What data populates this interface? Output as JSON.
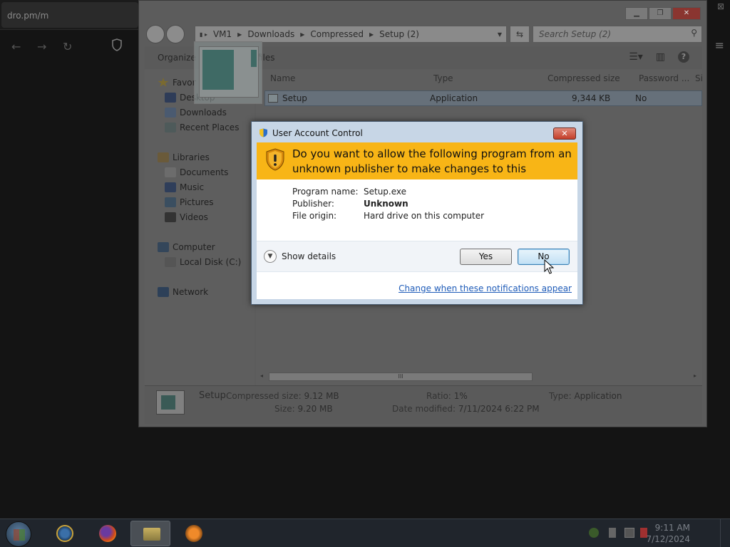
{
  "browser": {
    "tab_text": "dro.pm/m",
    "nav_glyphs": {
      "back": "←",
      "forward": "→",
      "reload": "↻"
    },
    "corner_close": "⊠",
    "menu_glyph": "≡"
  },
  "explorer": {
    "breadcrumb": [
      "VM1",
      "Downloads",
      "Compressed",
      "Setup (2)"
    ],
    "search_placeholder": "Search Setup (2)",
    "toolbar": {
      "organize": "Organize",
      "extract": "files"
    },
    "nav": {
      "favorites": "Favor",
      "favorites_items": [
        "Desktop",
        "Downloads",
        "Recent Places"
      ],
      "libraries": "Libraries",
      "libraries_items": [
        "Documents",
        "Music",
        "Pictures",
        "Videos"
      ],
      "computer": "Computer",
      "computer_items": [
        "Local Disk (C:)"
      ],
      "network": "Network"
    },
    "columns": [
      "Name",
      "Type",
      "Compressed size",
      "Password ...",
      "Si"
    ],
    "files": [
      {
        "name": "Setup",
        "type": "Application",
        "compressed_size": "9,344 KB",
        "password": "No"
      }
    ],
    "scroll_thumb": "III",
    "details": {
      "name": "Setup",
      "compressed_size_label": "Compressed size:",
      "compressed_size": "9.12 MB",
      "size_label": "Size:",
      "size": "9.20 MB",
      "ratio_label": "Ratio:",
      "ratio": "1%",
      "date_label": "Date modified:",
      "date": "7/11/2024 6:22 PM",
      "type_label": "Type:",
      "type": "Application"
    }
  },
  "uac": {
    "title": "User Account Control",
    "close_glyph": "✕",
    "question": "Do you want to allow the following program from an unknown publisher to make changes to this computer?",
    "program_name_label": "Program name:",
    "program_name": "Setup.exe",
    "publisher_label": "Publisher:",
    "publisher": "Unknown",
    "file_origin_label": "File origin:",
    "file_origin": "Hard drive on this computer",
    "show_details": "Show details",
    "yes": "Yes",
    "no": "No",
    "change_link": "Change when these notifications appear",
    "banner_color": "#f8b516"
  },
  "taskbar": {
    "time": "9:11 AM",
    "date": "7/12/2024"
  }
}
